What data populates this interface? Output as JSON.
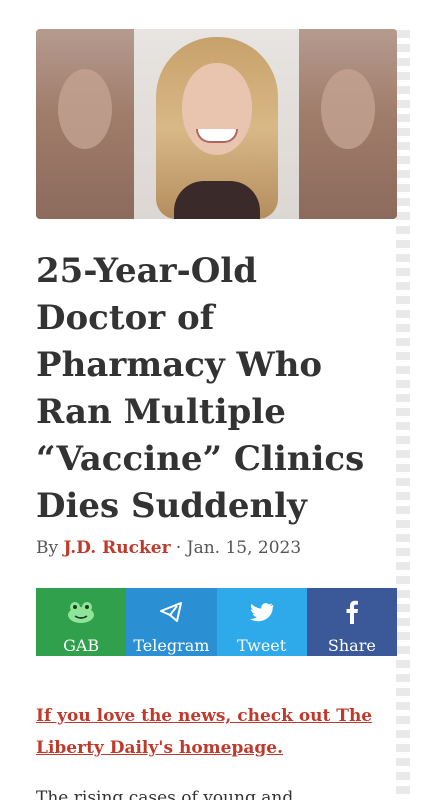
{
  "article": {
    "title_lines": [
      "25-Year-Old",
      "Doctor of",
      "Pharmacy Who",
      "Ran Multiple",
      "“Vaccine” Clinics",
      "Dies Suddenly"
    ],
    "byline": {
      "prefix": "By ",
      "author": "J.D. Rucker",
      "separator": " · ",
      "date": "Jan. 15, 2023"
    }
  },
  "share": {
    "buttons": [
      {
        "label": "GAB",
        "icon": "frog-icon",
        "color": "#30a04c"
      },
      {
        "label": "Telegram",
        "icon": "paper-plane-icon",
        "color": "#2b8fd3"
      },
      {
        "label": "Tweet",
        "icon": "bird-icon",
        "color": "#2ea9ea"
      },
      {
        "label": "Share",
        "icon": "facebook-f-icon",
        "color": "#3b5998"
      }
    ]
  },
  "promo": {
    "line1": "If you love the news, check out The",
    "line2": "Liberty Daily's homepage."
  },
  "body": {
    "first_line": "The rising cases of young and"
  },
  "colors": {
    "accent": "#c0392b",
    "text": "#333333"
  }
}
